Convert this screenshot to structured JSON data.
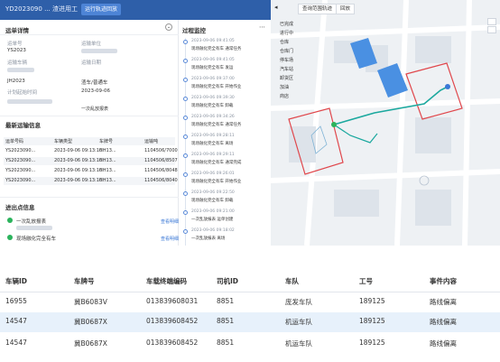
{
  "topbar": {
    "title": "YD2023090 ... 渣进用工",
    "button": "运行轨迹回放"
  },
  "left": {
    "section1_title": "运单详情",
    "fields": [
      {
        "label": "运单号",
        "value": "YS2023"
      },
      {
        "label": "运输单位",
        "value": ""
      },
      {
        "label": "运输车辆",
        "value": "渣车/普通车"
      },
      {
        "label": "车牌号码",
        "value": "JH2023"
      },
      {
        "label": "计划起始时间",
        "value": "2023-09-06"
      },
      {
        "label": "运输日期",
        "value": "新车规格"
      }
    ],
    "section2_title": "最新运输信息",
    "table_headers": [
      "运单号码",
      "车辆类型",
      "车牌号",
      "运输吨"
    ],
    "table_rows": [
      [
        "YS2023090...",
        "2023-09-06 09:13:16",
        "HH13...",
        "1104506/7000"
      ],
      [
        "YS2023090...",
        "2023-09-06 09:13:16",
        "HH13...",
        "1104506/8507"
      ],
      [
        "YS2023090...",
        "2023-09-06 09:13:16",
        "HH13...",
        "1104506/8048"
      ],
      [
        "YS2023090...",
        "2023-09-06 09:13:16",
        "HH13...",
        "1104506/8040"
      ]
    ],
    "section3_title": "进出点信息",
    "points": [
      {
        "name": "一次乱放报表",
        "action": "查看明细"
      },
      {
        "name": "现场融化完全有车",
        "action": "查看明细"
      }
    ]
  },
  "mid": {
    "title": "过程监控",
    "items": [
      {
        "time": "2023-09-06 09:41:05",
        "text": "现场融化完全有车  通常任务"
      },
      {
        "time": "2023-09-06 09:41:05",
        "text": "现场融化完全有车  发运"
      },
      {
        "time": "2023-09-06 09:37:00",
        "text": "现场融化完全有车  开始作业"
      },
      {
        "time": "2023-09-06 09:39:30",
        "text": "现场融化完全有车  卸载"
      },
      {
        "time": "2023-09-06 09:34:26",
        "text": "现场融化完全有车  通常任务"
      },
      {
        "time": "2023-09-06 09:28:11",
        "text": "现场融化完全有车  离场"
      },
      {
        "time": "2023-09-06 09:29:11",
        "text": "现场融化完全有车  通常完成"
      },
      {
        "time": "2023-09-06 09:26:01",
        "text": "现场融化完全有车  开始作业"
      },
      {
        "time": "2023-09-06 09:22:50",
        "text": "现场融化完全有车  卸载"
      },
      {
        "time": "2023-09-06 09:21:00",
        "text": "一次乱放报表  运单创建"
      },
      {
        "time": "2023-09-06 09:18:02",
        "text": "一次乱放报表  离场"
      }
    ]
  },
  "map": {
    "btn1": "查询范围轨迹",
    "btn2": "回放",
    "legend": [
      "已完成",
      "进行中",
      "仓库",
      "仓库门",
      "停车场",
      "汽车站",
      "卸货区",
      "加油",
      "商店"
    ]
  },
  "bottom_table": {
    "headers": [
      "车辆ID",
      "车牌号",
      "车载终端编码",
      "司机ID",
      "车队",
      "工号",
      "事件内容"
    ],
    "rows": [
      [
        "16955",
        "冀B6083V",
        "013839608031",
        "8851",
        "庞发车队",
        "189125",
        "路线偏离"
      ],
      [
        "14547",
        "冀B0687X",
        "013839608452",
        "8851",
        "机运车队",
        "189125",
        "路线偏离"
      ],
      [
        "14547",
        "冀B0687X",
        "013839608452",
        "8851",
        "机运车队",
        "189125",
        "路线偏离"
      ]
    ]
  },
  "colors": {
    "topbar": "#2e5fa9",
    "route_teal": "#1aa89e",
    "geofence_red": "#e0474c",
    "highlight_row": "#e7f1fb"
  }
}
